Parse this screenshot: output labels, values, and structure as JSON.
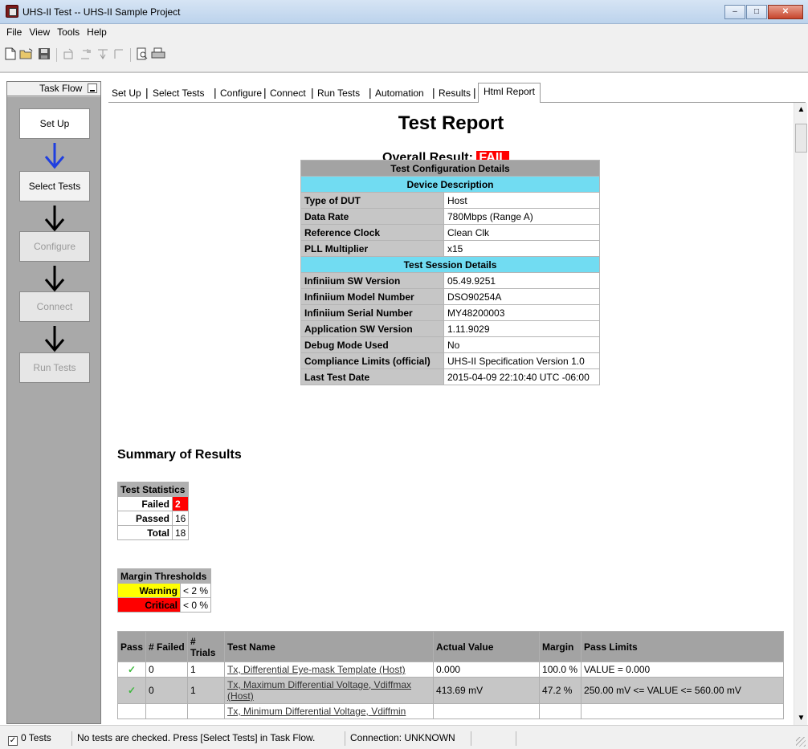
{
  "window": {
    "title": "UHS-II Test -- UHS-II Sample Project",
    "minimize": "–",
    "maximize": "□",
    "close": "✕"
  },
  "menu": [
    "File",
    "View",
    "Tools",
    "Help"
  ],
  "toolbar": [
    "new-icon",
    "open-icon",
    "save-icon",
    "import-icon",
    "export-icon",
    "run-icon",
    "stop-icon",
    "print-preview-icon",
    "print-icon"
  ],
  "taskflow": {
    "header": "Task Flow",
    "steps": [
      {
        "label": "Set Up",
        "state": "active"
      },
      {
        "label": "Select Tests",
        "state": "enabled"
      },
      {
        "label": "Configure",
        "state": "disabled"
      },
      {
        "label": "Connect",
        "state": "disabled"
      },
      {
        "label": "Run Tests",
        "state": "disabled"
      }
    ],
    "arrow_colors": [
      "#1f3fe0",
      "#000000",
      "#000000",
      "#000000"
    ]
  },
  "tabs": [
    "Set Up",
    "Select Tests",
    "Configure",
    "Connect",
    "Run Tests",
    "Automation",
    "Results",
    "Html Report"
  ],
  "active_tab": "Html Report",
  "report": {
    "title": "Test Report",
    "overall_label": "Overall Result:",
    "overall_value": "FAIL",
    "config": {
      "header": "Test Configuration Details",
      "device_header": "Device Description",
      "device_rows": [
        {
          "k": "Type of DUT",
          "v": "Host"
        },
        {
          "k": "Data Rate",
          "v": "780Mbps (Range A)"
        },
        {
          "k": "Reference Clock",
          "v": "Clean Clk"
        },
        {
          "k": "PLL Multiplier",
          "v": "x15"
        }
      ],
      "session_header": "Test Session Details",
      "session_rows": [
        {
          "k": "Infiniium SW Version",
          "v": "05.49.9251"
        },
        {
          "k": "Infiniium Model Number",
          "v": "DSO90254A"
        },
        {
          "k": "Infiniium Serial Number",
          "v": "MY48200003"
        },
        {
          "k": "Application SW Version",
          "v": "1.11.9029"
        },
        {
          "k": "Debug Mode Used",
          "v": "No"
        },
        {
          "k": "Compliance Limits (official)",
          "v": "UHS-II Specification Version 1.0"
        },
        {
          "k": "Last Test Date",
          "v": "2015-04-09 22:10:40 UTC -06:00"
        }
      ]
    },
    "summary_title": "Summary of Results",
    "stats": {
      "header": "Test Statistics",
      "rows": [
        {
          "k": "Failed",
          "v": "2"
        },
        {
          "k": "Passed",
          "v": "16"
        },
        {
          "k": "Total",
          "v": "18"
        }
      ]
    },
    "margins": {
      "header": "Margin Thresholds",
      "rows": [
        {
          "k": "Warning",
          "v": "< 2 %"
        },
        {
          "k": "Critical",
          "v": "< 0 %"
        }
      ]
    },
    "results": {
      "headers": [
        "Pass",
        "# Failed",
        "# Trials",
        "Test Name",
        "Actual Value",
        "Margin",
        "Pass Limits"
      ],
      "rows": [
        {
          "pass": "✓",
          "failed": "0",
          "trials": "1",
          "name": "Tx, Differential Eye-mask Template (Host)",
          "actual": "0.000",
          "margin": "100.0 %",
          "limits": "VALUE = 0.000"
        },
        {
          "pass": "✓",
          "failed": "0",
          "trials": "1",
          "name": "Tx, Maximum Differential Voltage, Vdiffmax (Host)",
          "actual": "413.69 mV",
          "margin": "47.2 %",
          "limits": "250.00 mV <= VALUE <= 560.00 mV"
        },
        {
          "pass": "",
          "failed": "",
          "trials": "",
          "name": "Tx, Minimum Differential Voltage, Vdiffmin",
          "actual": "",
          "margin": "",
          "limits": ""
        }
      ]
    }
  },
  "statusbar": {
    "tests": "0 Tests",
    "message": "No tests are checked. Press [Select Tests] in Task Flow.",
    "connection": "Connection: UNKNOWN"
  }
}
